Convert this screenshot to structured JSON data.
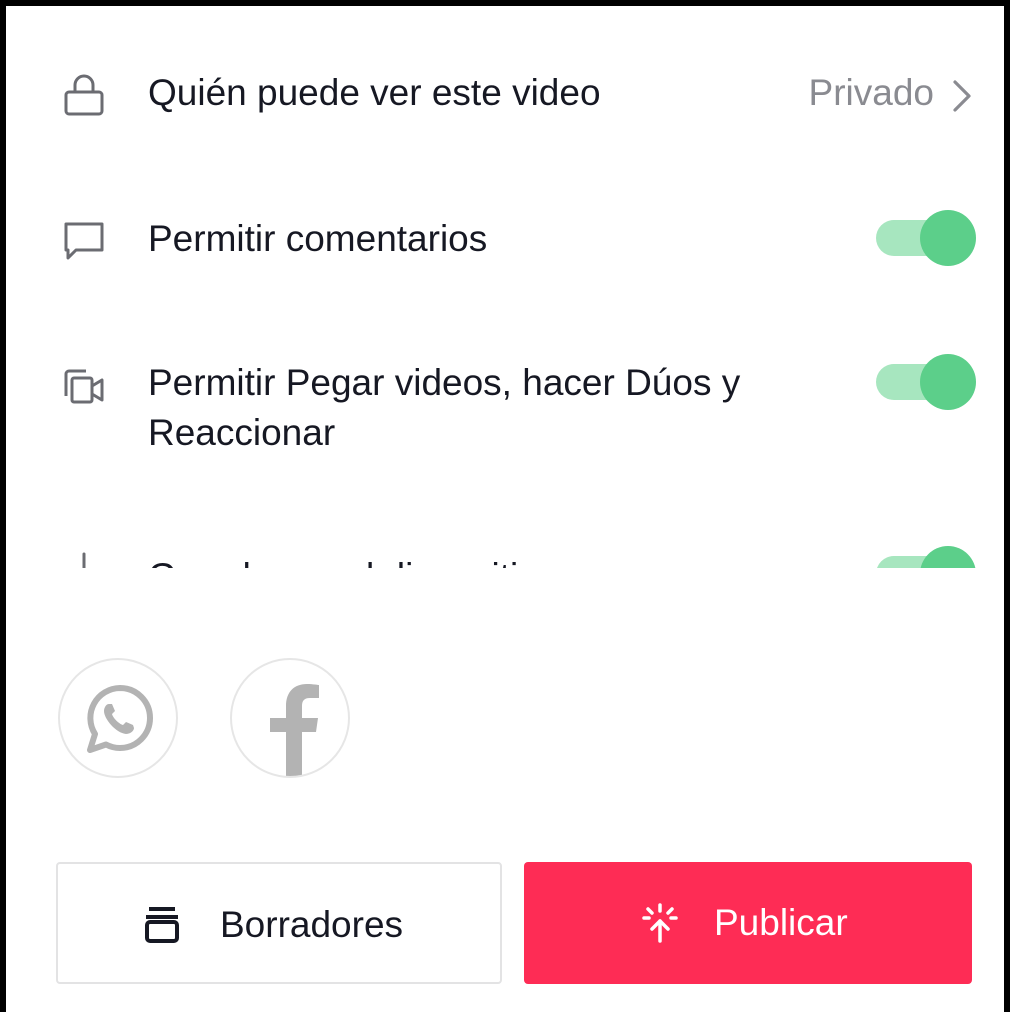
{
  "settings": {
    "who_can_view": {
      "label": "Quién puede ver este video",
      "value": "Privado",
      "icon": "lock-icon"
    },
    "allow_comments": {
      "label": "Permitir comentarios",
      "enabled": true,
      "icon": "comment-icon"
    },
    "allow_stitch_duet": {
      "label": "Permitir Pegar videos, hacer Dúos y Reaccionar",
      "enabled": true,
      "icon": "duet-icon"
    },
    "save_to_device": {
      "label": "Guardar en el dispositivo",
      "enabled": true,
      "icon": "download-icon"
    }
  },
  "share": {
    "items": [
      {
        "icon": "whatsapp-icon"
      },
      {
        "icon": "facebook-icon"
      }
    ]
  },
  "actions": {
    "drafts_label": "Borradores",
    "drafts_icon": "drafts-icon",
    "publish_label": "Publicar",
    "publish_icon": "publish-icon"
  },
  "colors": {
    "publish": "#fe2c55",
    "toggle_on_knob": "#5ccf8a",
    "toggle_on_track": "#a7e6bf",
    "secondary_text": "#8a8b91"
  }
}
